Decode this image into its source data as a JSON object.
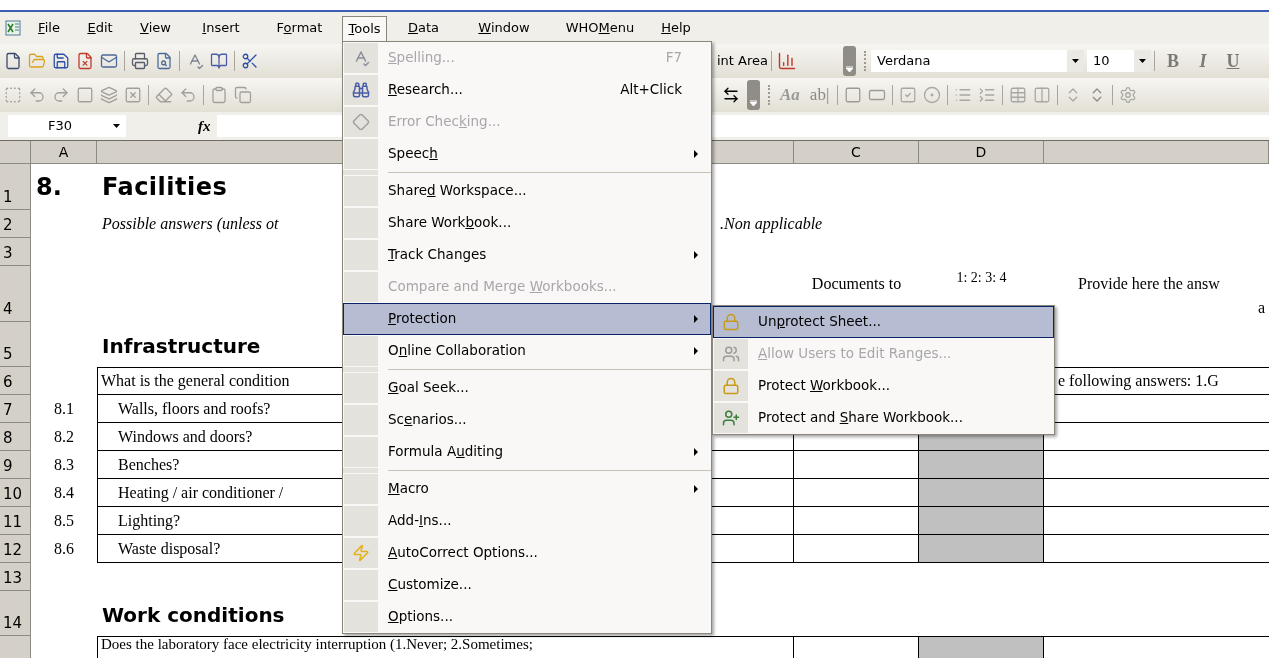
{
  "menu_bar": [
    {
      "key": "F",
      "post": "ile",
      "selected": false
    },
    {
      "key": "E",
      "post": "dit",
      "selected": false
    },
    {
      "key": "V",
      "post": "iew",
      "selected": false
    },
    {
      "key": "I",
      "post": "nsert",
      "selected": false
    },
    {
      "pre": "F",
      "key": "o",
      "post": "rmat",
      "selected": false
    },
    {
      "key": "T",
      "post": "ools",
      "selected": true
    },
    {
      "key": "D",
      "post": "ata",
      "selected": false
    },
    {
      "key": "W",
      "post": "indow",
      "selected": false
    },
    {
      "pre": "WHO",
      "key": "M",
      "post": "enu",
      "selected": false
    },
    {
      "key": "H",
      "post": "elp",
      "selected": false
    }
  ],
  "toolbar_1": {
    "print_area": "int Area",
    "font": "Verdana",
    "size": "10",
    "format_buttons": [
      "B",
      "I",
      "U"
    ]
  },
  "toolbar_2": {
    "label_tool": "Aa",
    "text_field_tool": "ab|"
  },
  "formula_bar": {
    "name_box": "F30",
    "function_label": "fx"
  },
  "column_headers": [
    "A",
    "C",
    "D"
  ],
  "rows": [
    {
      "number": "1",
      "kind": "title",
      "col_a": "8.",
      "col_b": "Facilities"
    },
    {
      "number": "2",
      "kind": "note",
      "col_b": "Possible answers (unless ot",
      "col_b_right": ".Non applicable"
    },
    {
      "number": "3",
      "kind": "blank"
    },
    {
      "number": "4",
      "kind": "headers",
      "col_c": "Documents to",
      "col_d": "1: 2: 3: 4",
      "col_e": "Provide here the answ",
      "col_e_line_2": "a"
    },
    {
      "number": "5",
      "kind": "section",
      "col_b": "Infrastructure"
    },
    {
      "number": "6",
      "kind": "group",
      "col_b": "What is the general condition",
      "col_e": "e following answers: 1.G"
    },
    {
      "number": "7",
      "kind": "question",
      "col_a": "8.1",
      "col_b": "Walls, floors and roofs?"
    },
    {
      "number": "8",
      "kind": "question",
      "col_a": "8.2",
      "col_b": "Windows and doors?"
    },
    {
      "number": "9",
      "kind": "question",
      "col_a": "8.3",
      "col_b": "Benches?"
    },
    {
      "number": "10",
      "kind": "question",
      "col_a": "8.4",
      "col_b": "Heating / air conditioner /"
    },
    {
      "number": "11",
      "kind": "question",
      "col_a": "8.5",
      "col_b": "Lighting?"
    },
    {
      "number": "12",
      "kind": "question",
      "col_a": "8.6",
      "col_b": "Waste disposal?"
    },
    {
      "number": "13",
      "kind": "blank"
    },
    {
      "number": "14",
      "kind": "section",
      "col_b": "Work conditions"
    },
    {
      "kind": "question_wide",
      "col_b": "Does the laboratory face electricity interruption (1.Never; 2.Sometimes;"
    }
  ],
  "tools_menu": {
    "items": [
      {
        "kind": "item",
        "key": "S",
        "post": "pelling...",
        "shortcut": "F7",
        "has_submenu": false,
        "disabled": true,
        "selected": false
      },
      {
        "kind": "item",
        "key": "R",
        "post": "esearch...",
        "shortcut": "Alt+Click",
        "has_submenu": false,
        "disabled": false,
        "selected": false
      },
      {
        "kind": "item",
        "pre": "Error Chec",
        "key": "k",
        "post": "ing...",
        "has_submenu": false,
        "disabled": true,
        "selected": false
      },
      {
        "kind": "item",
        "pre": "Speec",
        "key": "h",
        "has_submenu": true,
        "disabled": false,
        "selected": false
      },
      {
        "kind": "separator"
      },
      {
        "kind": "item",
        "pre": "Share",
        "key": "d",
        "post": " Workspace...",
        "has_submenu": false,
        "disabled": false,
        "selected": false
      },
      {
        "kind": "item",
        "pre": "Share Work",
        "key": "b",
        "post": "ook...",
        "has_submenu": false,
        "disabled": false,
        "selected": false
      },
      {
        "kind": "item",
        "key": "T",
        "post": "rack Changes",
        "has_submenu": true,
        "disabled": false,
        "selected": false
      },
      {
        "kind": "item",
        "pre": "Compare and Merge ",
        "key": "W",
        "post": "orkbooks...",
        "has_submenu": false,
        "disabled": true,
        "selected": false
      },
      {
        "kind": "item",
        "key": "P",
        "post": "rotection",
        "has_submenu": true,
        "disabled": false,
        "selected": true
      },
      {
        "kind": "item",
        "pre": "O",
        "key": "n",
        "post": "line Collaboration",
        "has_submenu": true,
        "disabled": false,
        "selected": false
      },
      {
        "kind": "separator"
      },
      {
        "kind": "item",
        "key": "G",
        "post": "oal Seek...",
        "has_submenu": false,
        "disabled": false,
        "selected": false
      },
      {
        "kind": "item",
        "pre": "Sc",
        "key": "e",
        "post": "narios...",
        "has_submenu": false,
        "disabled": false,
        "selected": false
      },
      {
        "kind": "item",
        "pre": "Formula A",
        "key": "u",
        "post": "diting",
        "has_submenu": true,
        "disabled": false,
        "selected": false
      },
      {
        "kind": "separator"
      },
      {
        "kind": "item",
        "key": "M",
        "post": "acro",
        "has_submenu": true,
        "disabled": false,
        "selected": false
      },
      {
        "kind": "item",
        "pre": "Add-",
        "key": "I",
        "post": "ns...",
        "has_submenu": false,
        "disabled": false,
        "selected": false
      },
      {
        "kind": "item",
        "key": "A",
        "post": "utoCorrect Options...",
        "has_submenu": false,
        "disabled": false,
        "selected": false
      },
      {
        "kind": "item",
        "key": "C",
        "post": "ustomize...",
        "has_submenu": false,
        "disabled": false,
        "selected": false
      },
      {
        "kind": "item",
        "key": "O",
        "post": "ptions...",
        "has_submenu": false,
        "disabled": false,
        "selected": false
      }
    ]
  },
  "protection_submenu": {
    "items": [
      {
        "kind": "item",
        "pre": "Un",
        "key": "p",
        "post": "rotect Sheet...",
        "has_submenu": false,
        "disabled": false,
        "selected": true
      },
      {
        "kind": "item",
        "key": "A",
        "post": "llow Users to Edit Ranges...",
        "has_submenu": false,
        "disabled": true,
        "selected": false
      },
      {
        "kind": "item",
        "pre": "Protect ",
        "key": "W",
        "post": "orkbook...",
        "has_submenu": false,
        "disabled": false,
        "selected": false
      },
      {
        "kind": "item",
        "pre": "Protect and ",
        "key": "S",
        "post": "hare Workbook...",
        "has_submenu": false,
        "disabled": false,
        "selected": false
      }
    ]
  }
}
